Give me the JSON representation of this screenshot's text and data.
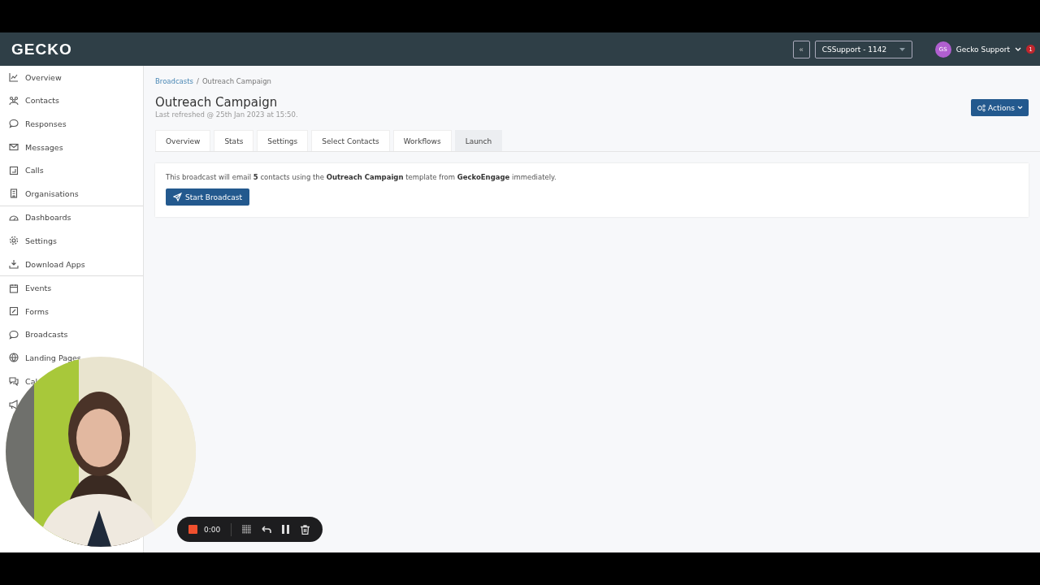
{
  "header": {
    "logo": "GECKO",
    "collapse_button": "«",
    "account_select": "CSSupport - 1142",
    "user": {
      "initials": "GS",
      "name": "Gecko Support",
      "notifications": "1"
    }
  },
  "sidebar": {
    "groups": [
      [
        {
          "kind": "labeled",
          "label": "Overview"
        },
        {
          "kind": "labeled",
          "label": "Contacts"
        },
        {
          "kind": "labeled",
          "label": "Responses"
        },
        {
          "kind": "labeled",
          "label": "Messages"
        },
        {
          "kind": "labeled",
          "label": "Calls"
        },
        {
          "kind": "labeled",
          "label": "Organisations"
        }
      ],
      [
        {
          "kind": "labeled",
          "label": "Dashboards"
        },
        {
          "kind": "labeled",
          "label": "Settings"
        },
        {
          "kind": "labeled",
          "label": "Download Apps"
        }
      ],
      [
        {
          "kind": "labeled",
          "label": "Events"
        },
        {
          "kind": "labeled",
          "label": "Forms"
        },
        {
          "kind": "labeled",
          "label": "Broadcasts"
        },
        {
          "kind": "labeled",
          "label": "Landing Pages"
        },
        {
          "kind": "labeled",
          "label": "Cal"
        },
        {
          "kind": "icon_only"
        }
      ]
    ]
  },
  "breadcrumb": {
    "separator": "/",
    "items": [
      "Broadcasts",
      "Outreach Campaign"
    ]
  },
  "page": {
    "title": "Outreach Campaign",
    "subtitle": "Last refreshed @ 25th Jan 2023 at 15:50.",
    "actions_button": "Actions"
  },
  "tabs": [
    {
      "label": "Overview",
      "selected": false
    },
    {
      "label": "Stats",
      "selected": false
    },
    {
      "label": "Settings",
      "selected": false
    },
    {
      "label": "Select Contacts",
      "selected": false
    },
    {
      "label": "Workflows",
      "selected": false
    },
    {
      "label": "Launch",
      "selected": true
    }
  ],
  "launch": {
    "message": "This broadcast will email **5** contacts using the **Outreach Campaign** template from **GeckoEngage** immediately.",
    "button": "Start Broadcast"
  },
  "recorder": {
    "time": "0:00"
  }
}
